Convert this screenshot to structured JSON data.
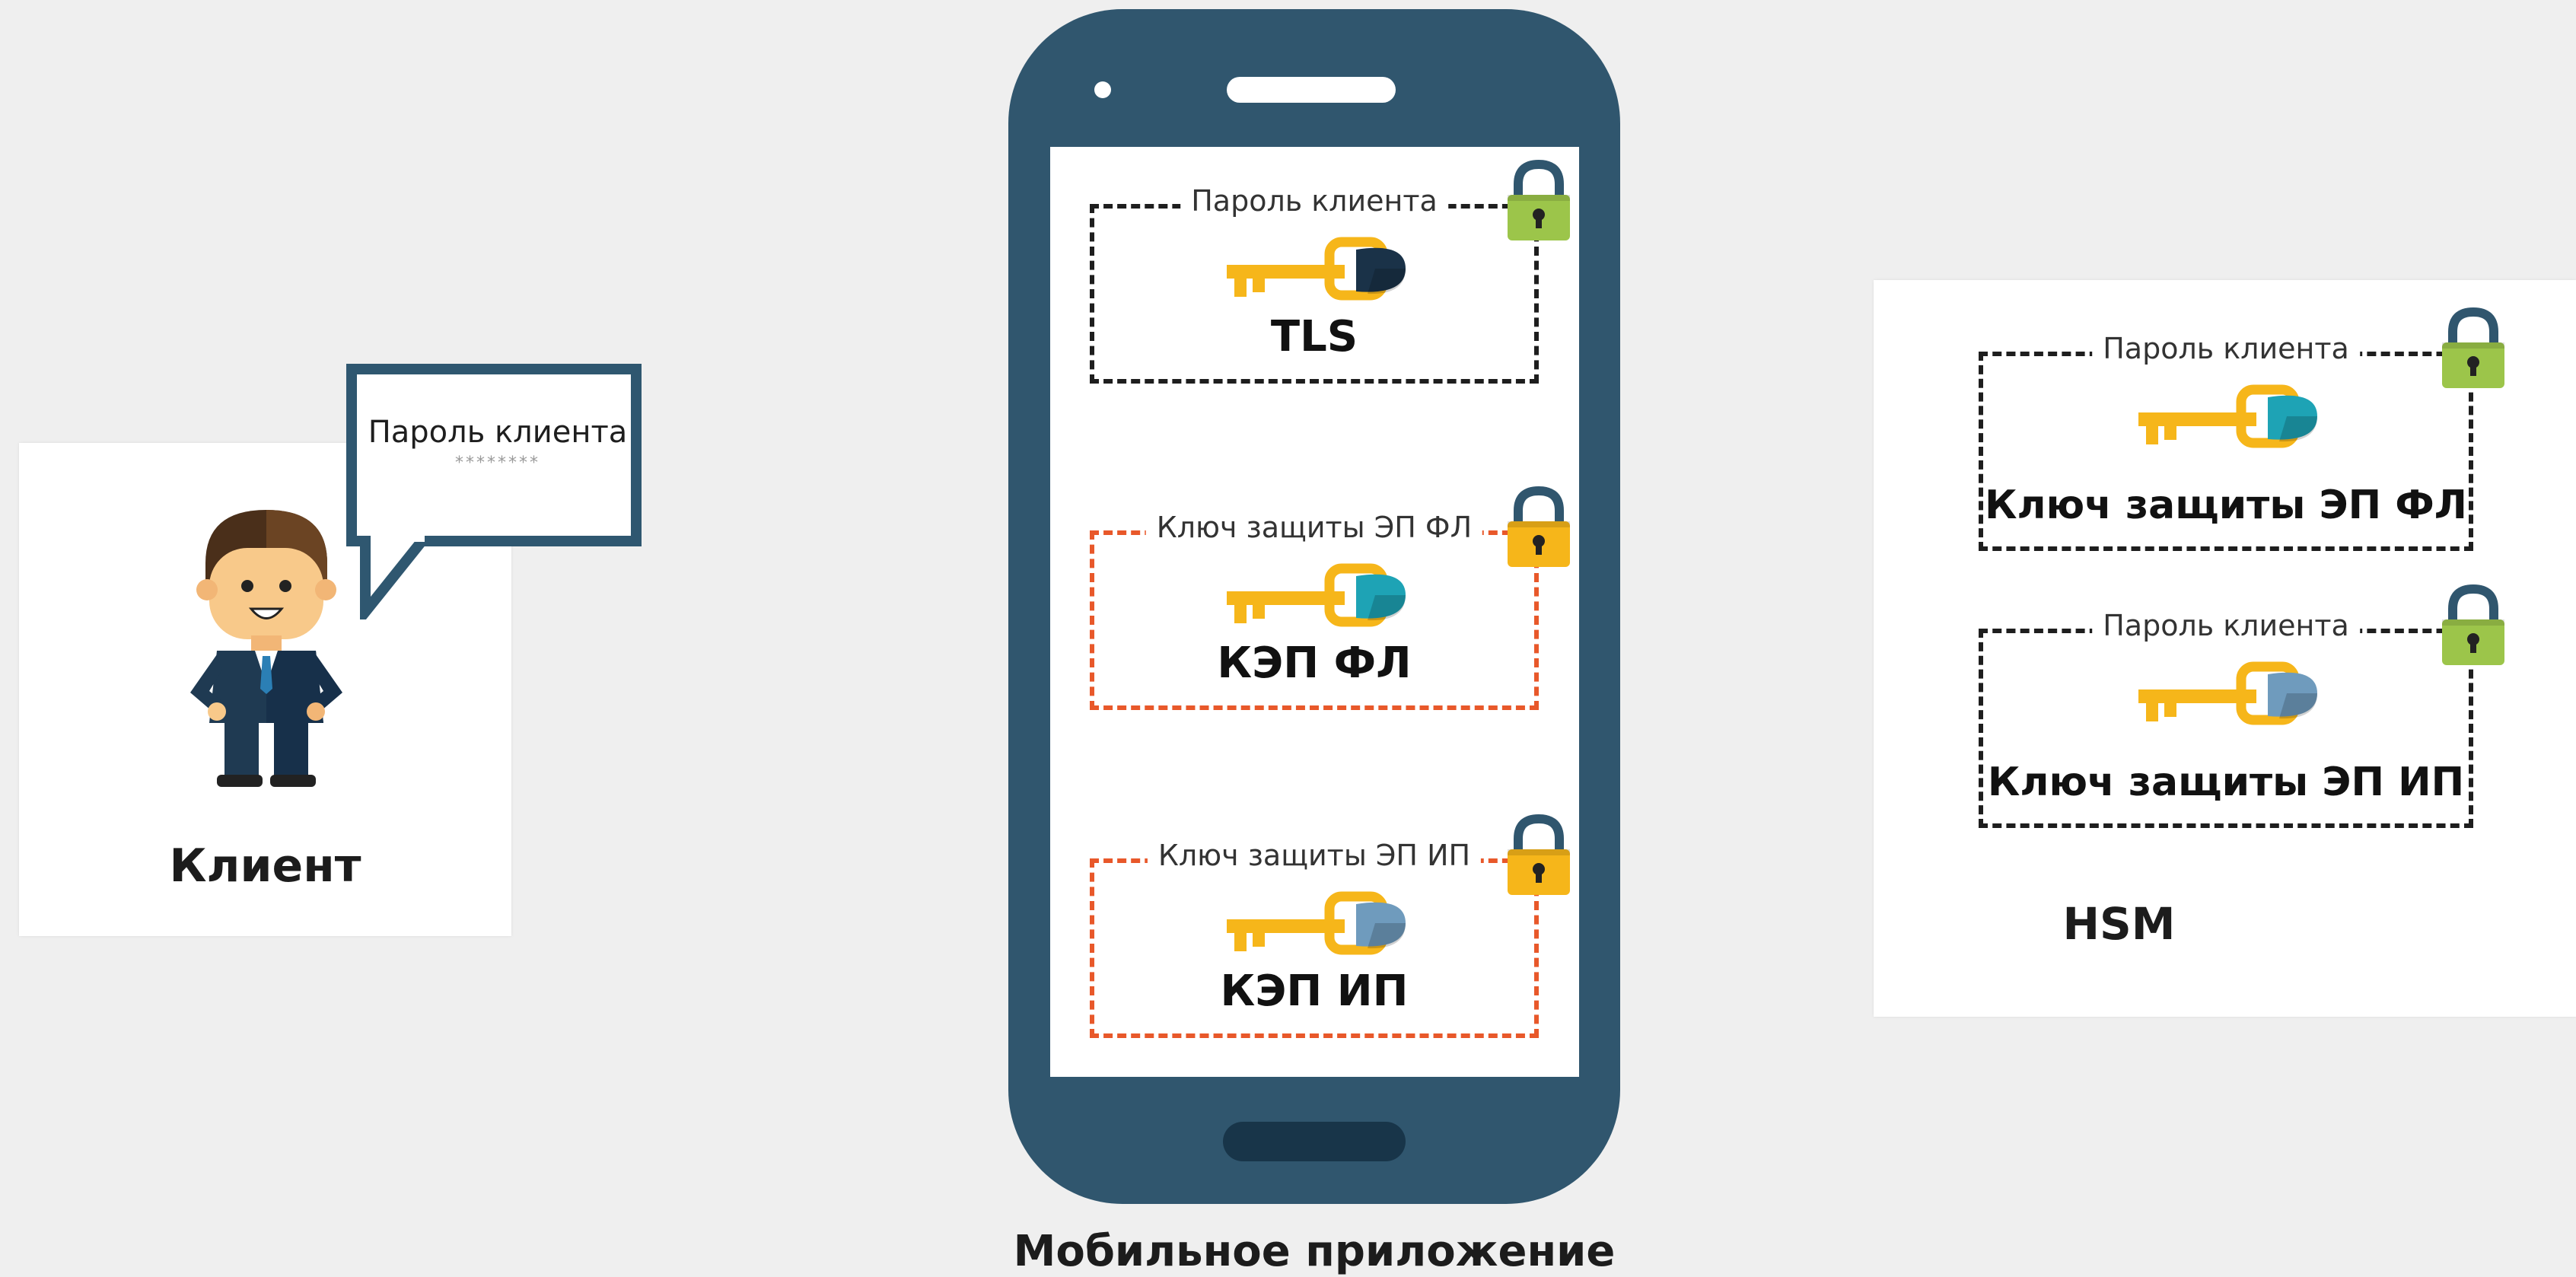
{
  "client": {
    "label": "Клиент",
    "bubble_title": "Пароль клиента",
    "bubble_stars": "********"
  },
  "phone": {
    "label": "Мобильное приложение",
    "boxes": [
      {
        "title": "Пароль клиента",
        "label": "TLS",
        "border": "#1e1e1e",
        "lock": "#9cc54a",
        "key_head": "#1a3248"
      },
      {
        "title": "Ключ защиты ЭП ФЛ",
        "label": "КЭП ФЛ",
        "border": "#e8582a",
        "lock": "#f6b61a",
        "key_head": "#1ea3b5"
      },
      {
        "title": "Ключ защиты ЭП ИП",
        "label": "КЭП ИП",
        "border": "#e8582a",
        "lock": "#f6b61a",
        "key_head": "#6f9bbd"
      }
    ]
  },
  "hsm": {
    "label": "HSM",
    "boxes": [
      {
        "title": "Пароль клиента",
        "label": "Ключ защиты ЭП ФЛ",
        "border": "#1e1e1e",
        "lock": "#9cc54a",
        "key_head": "#1ea3b5"
      },
      {
        "title": "Пароль клиента",
        "label": "Ключ защиты ЭП ИП",
        "border": "#1e1e1e",
        "lock": "#9cc54a",
        "key_head": "#6f9bbd"
      }
    ]
  },
  "icons": [
    "person-icon",
    "speech-bubble-icon",
    "key-icon",
    "lock-icon",
    "smartphone-icon"
  ],
  "colors": {
    "phone_body": "#30566e",
    "key_gold": "#f6b61a",
    "lock_green": "#9cc54a",
    "lock_orange": "#f6b61a",
    "dashed_orange": "#e8582a"
  }
}
